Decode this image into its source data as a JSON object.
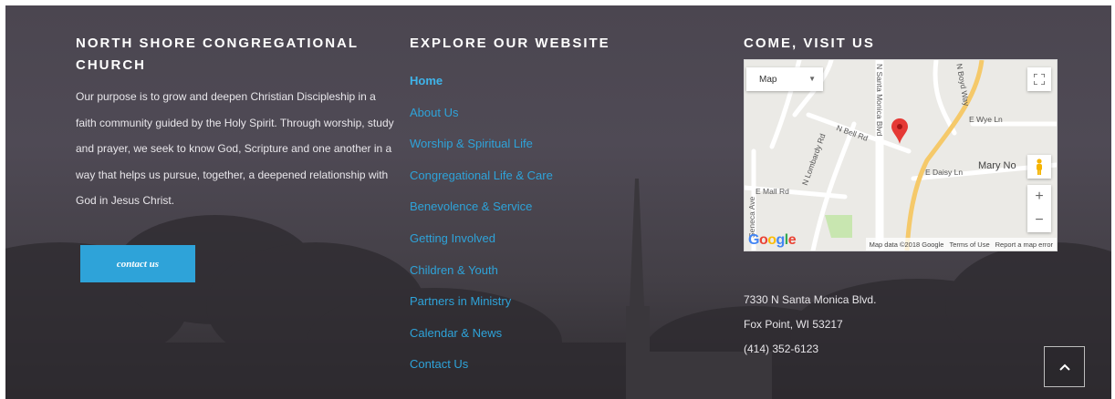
{
  "about": {
    "title": "NORTH SHORE CONGREGATIONAL CHURCH",
    "text": "Our purpose is to grow and deepen Christian Discipleship in a faith community guided by the Holy Spirit. Through worship, study and prayer, we seek to know God, Scripture and one another in a way that helps us pursue, together, a deepened relationship with God in Jesus Christ.",
    "button_label": "contact us"
  },
  "explore": {
    "title": "EXPLORE OUR WEBSITE",
    "links": [
      {
        "label": "Home"
      },
      {
        "label": "About Us"
      },
      {
        "label": "Worship & Spiritual Life"
      },
      {
        "label": "Congregational Life & Care"
      },
      {
        "label": "Benevolence & Service"
      },
      {
        "label": "Getting Involved"
      },
      {
        "label": "Children & Youth"
      },
      {
        "label": "Partners in Ministry"
      },
      {
        "label": "Calendar & News"
      },
      {
        "label": "Contact Us"
      }
    ]
  },
  "visit": {
    "title": "COME, VISIT US",
    "map": {
      "type_selector": "Map",
      "roads": [
        "N Santa Monica Blvd",
        "N Bell Rd",
        "N Lombardy Rd",
        "N Boyd Way",
        "E Wye Ln",
        "E Daisy Ln",
        "E Mall Rd",
        "Seneca Ave"
      ],
      "poi": "Mary No",
      "zoom_in": "+",
      "zoom_out": "−",
      "logo": "Google",
      "attribution": [
        "Map data ©2018 Google",
        "Terms of Use",
        "Report a map error"
      ]
    },
    "address_line1": "7330 N Santa Monica Blvd.",
    "address_line2": "Fox Point, WI 53217",
    "phone": "(414) 352-6123"
  },
  "scroll_top_icon": "chevron-up-icon",
  "colors": {
    "accent": "#2ea3d9",
    "background": "#4b4650",
    "marker": "#e53935"
  }
}
